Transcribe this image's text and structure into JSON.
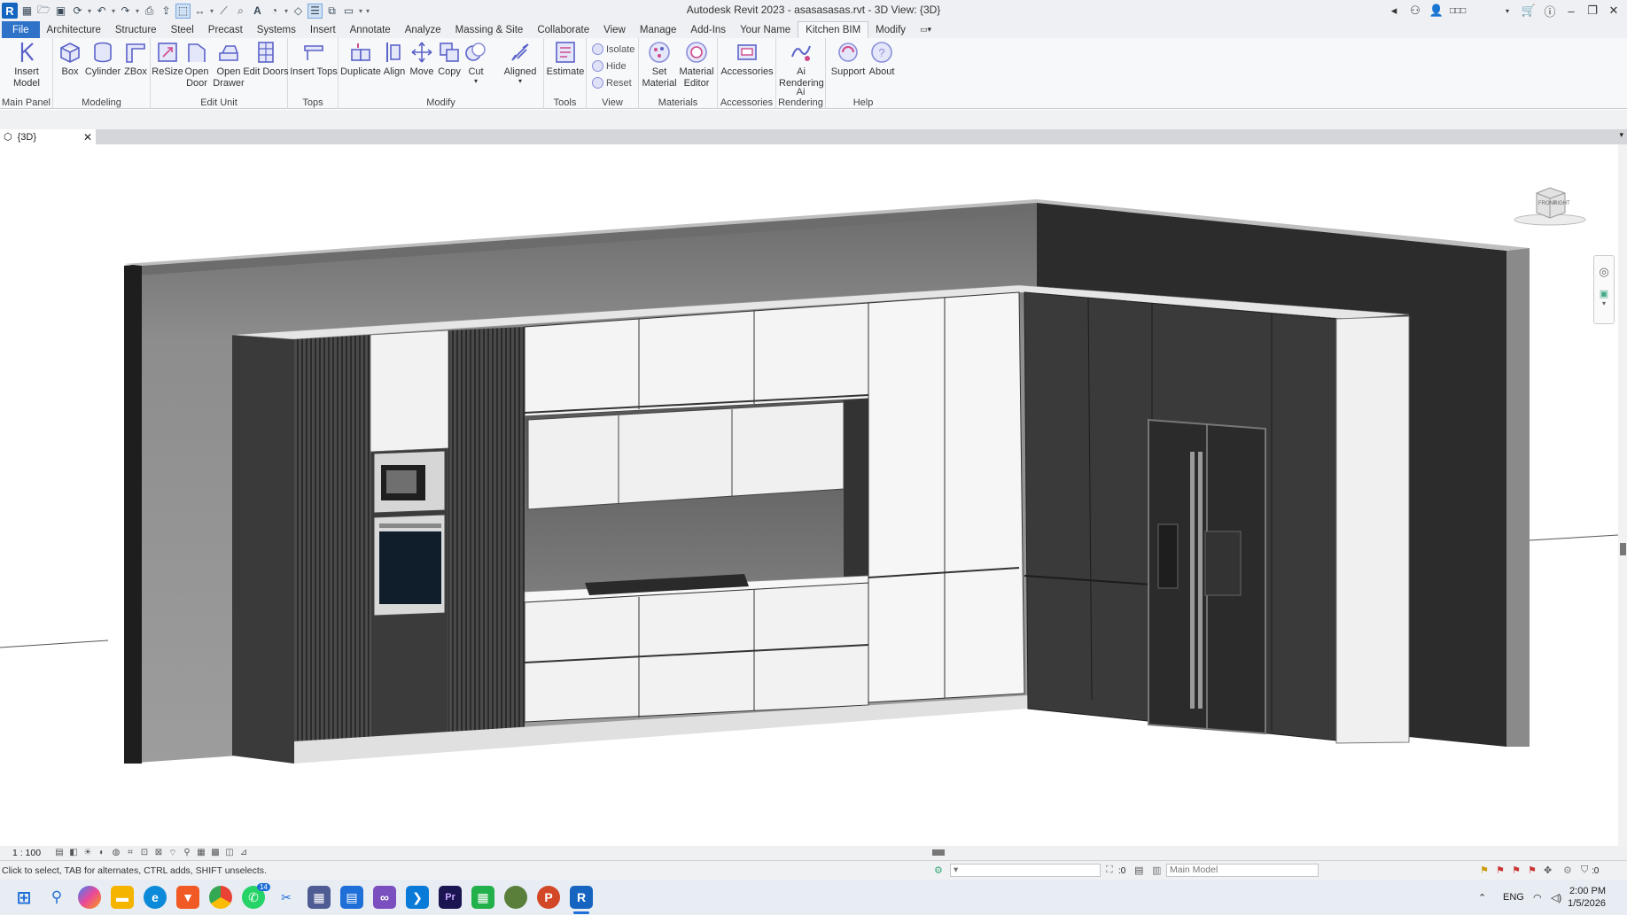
{
  "title": "Autodesk Revit 2023 - asasasasas.rvt - 3D View: {3D}",
  "qat": {
    "icons": [
      "open-icon",
      "save-icon",
      "sync-icon",
      "undo-icon",
      "redo-icon",
      "print-icon",
      "measure-icon",
      "dimension-icon",
      "tag-icon",
      "text-icon",
      "default-3d-icon",
      "section-icon",
      "thin-lines-icon",
      "close-hidden-icon",
      "switch-windows-icon"
    ]
  },
  "titlebar_right": {
    "user_label": "□□□"
  },
  "ribbon_tabs": [
    "File",
    "Architecture",
    "Structure",
    "Steel",
    "Precast",
    "Systems",
    "Insert",
    "Annotate",
    "Analyze",
    "Massing & Site",
    "Collaborate",
    "View",
    "Manage",
    "Add-Ins",
    "Your Name",
    "Kitchen BIM",
    "Modify"
  ],
  "active_tab": "Kitchen BIM",
  "panels": {
    "main_panel": {
      "title": "Main Panel",
      "tools": [
        {
          "label": "Insert Model"
        }
      ]
    },
    "modeling": {
      "title": "Modeling",
      "tools": [
        {
          "label": "Box"
        },
        {
          "label": "Cylinder"
        },
        {
          "label": "ZBox"
        }
      ]
    },
    "edit_unit": {
      "title": "Edit Unit",
      "tools": [
        {
          "label": "ReSize"
        },
        {
          "label": "Open Door"
        },
        {
          "label": "Open Drawer"
        },
        {
          "label": "Edit Doors"
        }
      ]
    },
    "tops": {
      "title": "Tops",
      "tools": [
        {
          "label": "Insert Tops"
        }
      ]
    },
    "modify": {
      "title": "Modify",
      "tools": [
        {
          "label": "Duplicate"
        },
        {
          "label": "Align"
        },
        {
          "label": "Move"
        },
        {
          "label": "Copy"
        },
        {
          "label": "Cut"
        },
        {
          "label": "Aligned"
        }
      ]
    },
    "tools": {
      "title": "Tools",
      "tools": [
        {
          "label": "Estimate"
        }
      ]
    },
    "view": {
      "title": "View",
      "tools": [
        {
          "label": "Isolate"
        },
        {
          "label": "Hide"
        },
        {
          "label": "Reset"
        }
      ]
    },
    "materials": {
      "title": "Materials",
      "tools": [
        {
          "label": "Set Material"
        },
        {
          "label": "Material Editor"
        }
      ]
    },
    "accessories": {
      "title": "Accessories",
      "tools": [
        {
          "label": "Accessories"
        }
      ]
    },
    "ai_rendering": {
      "title": "Ai Rendering",
      "tools": [
        {
          "label": "Ai Rendering"
        }
      ]
    },
    "help": {
      "title": "Help",
      "tools": [
        {
          "label": "Support"
        },
        {
          "label": "About"
        }
      ]
    }
  },
  "view_tab": {
    "label": "{3D}"
  },
  "viewcube": {
    "front": "FRONT",
    "right": "RIGHT"
  },
  "view_control": {
    "scale": "1 : 100"
  },
  "status": {
    "text": "Click to select, TAB for alternates, CTRL adds, SHIFT unselects.",
    "selection_count": ":0",
    "model": "Main Model",
    "filter_count": ":0"
  },
  "taskbar": {
    "lang": "ENG",
    "time": "2:00 PM",
    "date": "1/5/2026",
    "whatsapp_badge": "14"
  },
  "colors": {
    "accent": "#2f73c8",
    "ribbon_bg": "#f7f8fa",
    "taskbar_bg": "#e8ecf3"
  }
}
